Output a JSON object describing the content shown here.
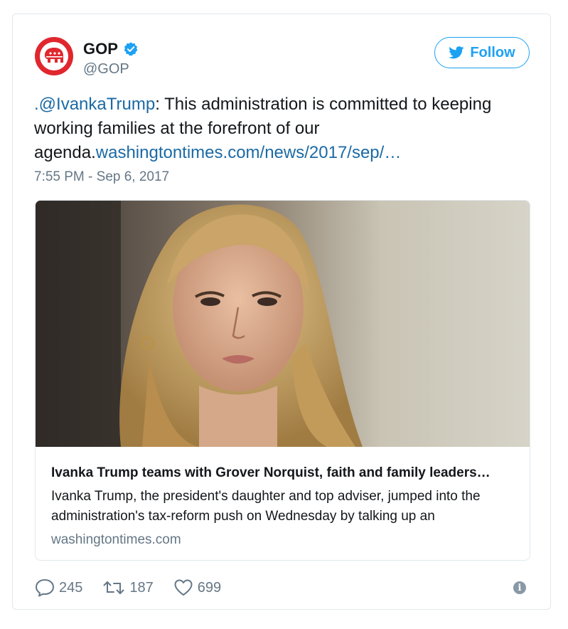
{
  "tweet": {
    "author_name": "GOP",
    "author_handle": "@GOP",
    "follow_label": "Follow",
    "mention": ".@IvankaTrump",
    "body_text": ": This administration is committed to keeping working families at the forefront of our agenda.",
    "link_text": "washingtontimes.com/news/2017/sep/…",
    "timestamp": "7:55 PM - Sep 6, 2017",
    "card": {
      "title": "Ivanka Trump teams with Grover Norquist, faith and family leaders…",
      "description": "Ivanka Trump, the president's daughter and top adviser, jumped into the administration's tax-reform push on Wednesday by talking up an",
      "domain": "washingtontimes.com"
    },
    "replies": "245",
    "retweets": "187",
    "likes": "699"
  },
  "colors": {
    "brand_blue": "#1da1f2",
    "link_blue": "#1b6aa5",
    "gop_red": "#e0272e",
    "muted_gray": "#657786"
  }
}
